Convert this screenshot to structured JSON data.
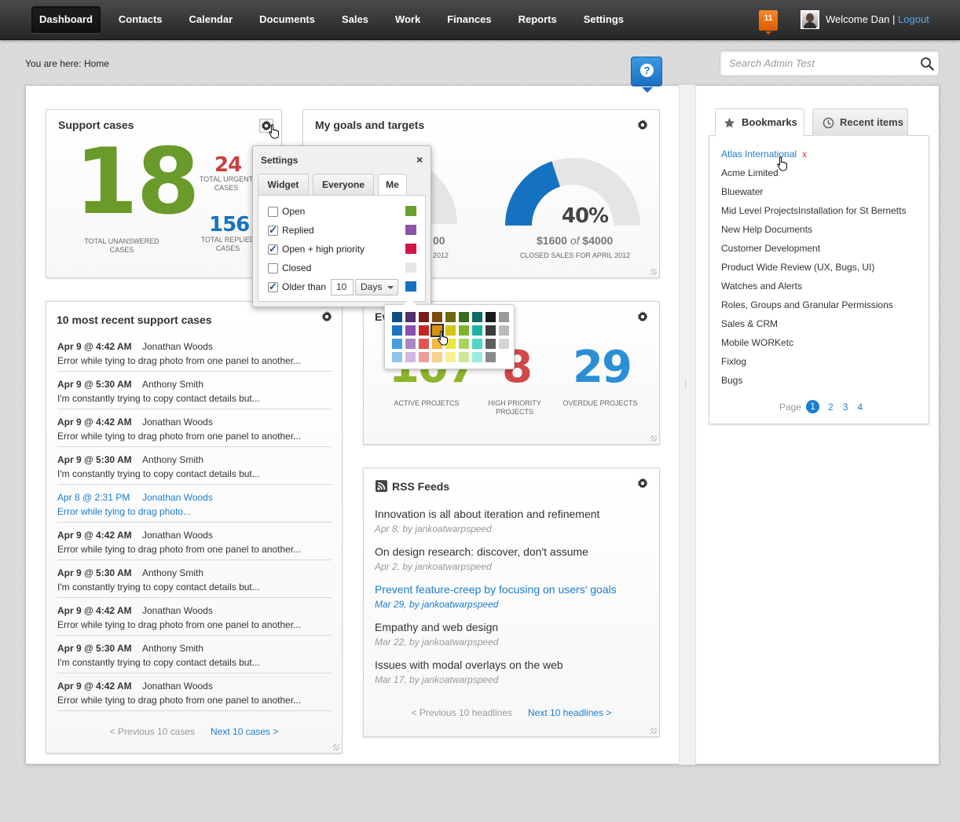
{
  "nav": {
    "items": [
      "Dashboard",
      "Contacts",
      "Calendar",
      "Documents",
      "Sales",
      "Work",
      "Finances",
      "Reports",
      "Settings"
    ],
    "notification_count": "11",
    "welcome_text": "Welcome Dan |",
    "logout": "Logout"
  },
  "breadcrumb": "You are here: Home",
  "search": {
    "placeholder": "Search Admin Test"
  },
  "help_label": "?",
  "support": {
    "title": "Support cases",
    "unanswered": "18",
    "unanswered_label": "TOTAL UNANSWERED CASES",
    "urgent": "24",
    "urgent_label": "TOTAL URGENT CASES",
    "replied": "156",
    "replied_label": "TOTAL REPLIED CASES"
  },
  "goals": {
    "title": "My goals and targets",
    "gauge1_amount": "00",
    "gauge1_caption": "2012",
    "gauge1_fraction": 0.6,
    "gauge2_percent": "40%",
    "gauge2_amount": "$1600",
    "gauge2_of": "of",
    "gauge2_target": "$4000",
    "gauge2_caption": "CLOSED SALES FOR APRIL 2012",
    "gauge2_fraction": 0.4,
    "colors": {
      "orange": "#f0900f",
      "blue": "#1572c0"
    }
  },
  "settings_popup": {
    "title": "Settings",
    "close": "×",
    "tabs": [
      "Widget",
      "Everyone",
      "Me"
    ],
    "active_tab": "Me",
    "rows": [
      {
        "label": "Open",
        "checked": false,
        "color": "#6aa02d"
      },
      {
        "label": "Replied",
        "checked": true,
        "color": "#8e53a7"
      },
      {
        "label": "Open + high priority",
        "checked": true,
        "color": "#d01446"
      },
      {
        "label": "Closed",
        "checked": false,
        "color": "#e6e6e6"
      },
      {
        "label": "Older than",
        "checked": true,
        "color": "#1572c0"
      }
    ],
    "older_value": "10",
    "older_unit": "Days"
  },
  "palette_colors": [
    "#104e84",
    "#4f2f6e",
    "#7a1b1b",
    "#7a4a06",
    "#6e6a0b",
    "#3a6b16",
    "#0d6b63",
    "#1a1a1a",
    "#9a9a9a",
    "#1b74c4",
    "#8a4fb0",
    "#c62525",
    "#d9900d",
    "#d6c412",
    "#7db528",
    "#19b3a3",
    "#3a3a3a",
    "#bababa",
    "#4a9ce0",
    "#aa86c8",
    "#e35353",
    "#f3b53a",
    "#ece443",
    "#a9d35c",
    "#4fd6c7",
    "#5e5e5e",
    "#d4d4d4",
    "#8ec3ee",
    "#d1b6e3",
    "#f09a9a",
    "#f8d08a",
    "#f6f08e",
    "#cde69a",
    "#97ecdf",
    "#8a8a8a",
    "#ffffff"
  ],
  "recent_cases": {
    "title": "10 most recent support cases",
    "items": [
      {
        "date": "Apr 9 @ 4:42 AM",
        "name": "Jonathan Woods",
        "text": "Error while tying to drag photo from one panel to another..."
      },
      {
        "date": "Apr 9 @ 5:30 AM",
        "name": "Anthony Smith",
        "text": "I'm constantly trying to copy contact details but..."
      },
      {
        "date": "Apr 9 @ 4:42 AM",
        "name": "Jonathan Woods",
        "text": "Error while tying to drag photo from one panel to another..."
      },
      {
        "date": "Apr 9 @ 5:30 AM",
        "name": "Anthony Smith",
        "text": "I'm constantly trying to copy contact details but..."
      },
      {
        "date": "Apr 8",
        "time": "@ 2:31 PM",
        "name": "Jonathan Woods",
        "text": "Error while tying to drag photo..."
      },
      {
        "date": "Apr 9 @ 4:42 AM",
        "name": "Jonathan Woods",
        "text": "Error while tying to drag photo from one panel to another..."
      },
      {
        "date": "Apr 9 @ 5:30 AM",
        "name": "Anthony Smith",
        "text": "I'm constantly trying to copy contact details but..."
      },
      {
        "date": "Apr 9 @ 4:42 AM",
        "name": "Jonathan Woods",
        "text": "Error while tying to drag photo from one panel to another..."
      },
      {
        "date": "Apr 9 @ 5:30 AM",
        "name": "Anthony Smith",
        "text": "I'm constantly trying to copy contact details but..."
      },
      {
        "date": "Apr 9 @ 4:42 AM",
        "name": "Jonathan Woods",
        "text": "Error while tying to drag photo from one panel to another..."
      }
    ],
    "prev": "< Previous 10 cases",
    "next": "Next 10 cases >"
  },
  "projects": {
    "title_start": "Ev",
    "active": "107",
    "active_label": "ACTIVE PROJETCS",
    "high": "8",
    "high_label": "HIGH PRIORITY PROJECTS",
    "overdue": "29",
    "overdue_label": "OVERDUE PROJECTS"
  },
  "rss": {
    "title": "RSS Feeds",
    "items": [
      {
        "title": "Innovation is all about iteration and refinement",
        "meta": "Apr 8, by jankoatwarpspeed"
      },
      {
        "title": "On design research: discover, don't assume",
        "meta": "Apr 2, by jankoatwarpspeed"
      },
      {
        "title": "Prevent feature-creep by focusing on users' goals",
        "meta": "Mar 29, by jankoatwarpspeed"
      },
      {
        "title": "Empathy and web design",
        "meta": "Mar 22, by jankoatwarpspeed"
      },
      {
        "title": "Issues with modal overlays on the web",
        "meta": "Mar 17, by jankoatwarpspeed"
      }
    ],
    "prev": "< Previous 10 headlines",
    "next": "Next 10 headlines >"
  },
  "bookmarks": {
    "tab_bookmarks": "Bookmarks",
    "tab_recent": "Recent items",
    "items": [
      "Atlas International",
      "Acme Limited",
      "Bluewater",
      "Mid Level ProjectsInstallation for St Bernetts",
      "New Help Documents",
      "Customer Development",
      "Product Wide Review (UX, Bugs, UI)",
      "Watches and Alerts",
      "Roles, Groups and Granular Permissions",
      "Sales & CRM",
      "Mobile WORKetc",
      "Fixlog",
      "Bugs"
    ],
    "remove": "x",
    "page_label": "Page",
    "pages": [
      "1",
      "2",
      "3",
      "4"
    ],
    "current_page": "1"
  }
}
